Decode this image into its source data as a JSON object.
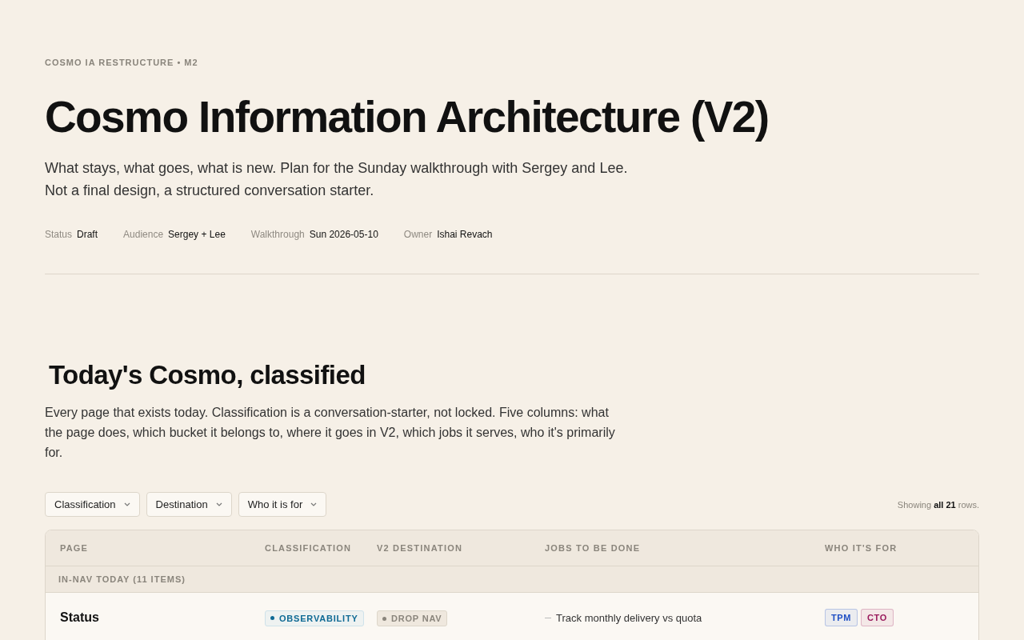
{
  "eyebrow": "COSMO IA RESTRUCTURE • M2",
  "title": "Cosmo Information Architecture (V2)",
  "intro": "What stays, what goes, what is new. Plan for the Sunday walkthrough with Sergey and Lee. Not a final design, a structured conversation starter.",
  "meta": [
    {
      "label": "Status",
      "value": "Draft"
    },
    {
      "label": "Audience",
      "value": "Sergey + Lee"
    },
    {
      "label": "Walkthrough",
      "value": "Sun 2026-05-10"
    },
    {
      "label": "Owner",
      "value": "Ishai Revach"
    }
  ],
  "section": {
    "title": "Today's Cosmo, classified",
    "description": "Every page that exists today. Classification is a conversation-starter, not locked. Five columns: what the page does, which bucket it belongs to, where it goes in V2, which jobs it serves, who it's primarily for."
  },
  "filters": [
    "Classification",
    "Destination",
    "Who it is for"
  ],
  "row_count": "Showing **all 21** rows.",
  "table": {
    "columns": [
      "PAGE",
      "CLASSIFICATION",
      "V2 DESTINATION",
      "JOBS TO BE DONE",
      "WHO IT'S FOR"
    ],
    "groups": [
      {
        "label": "IN-NAV TODAY (11 ITEMS)",
        "rows": [
          {
            "page": "Status",
            "classification": {
              "label": "OBSERVABILITY",
              "color": "#0f6a94"
            },
            "destination": {
              "label": "DROP NAV",
              "color": "#8a857c"
            },
            "jobs": [
              "Track monthly delivery vs quota"
            ],
            "audience": [
              {
                "label": "TPM",
                "color": "#1f4fc4"
              },
              {
                "label": "CTO",
                "color": "#9a1a5c"
              }
            ]
          }
        ]
      }
    ]
  }
}
